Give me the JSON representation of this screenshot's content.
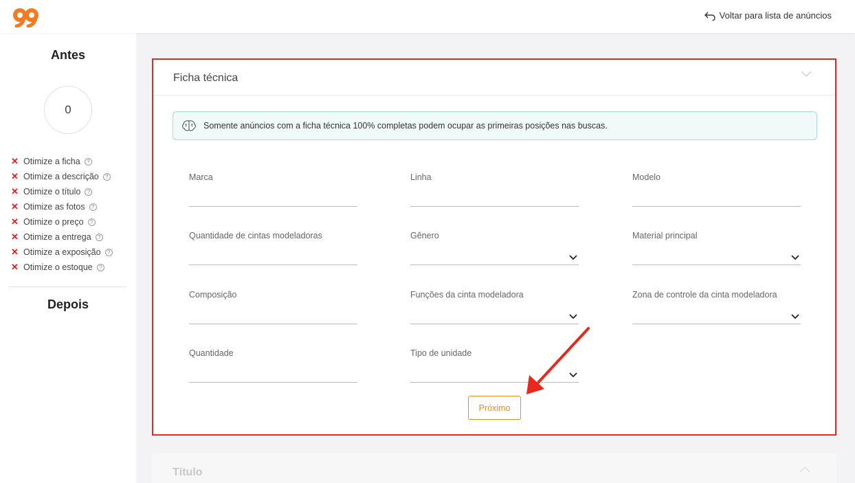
{
  "header": {
    "back_label": "Voltar para lista de anúncios"
  },
  "sidebar": {
    "antes_title": "Antes",
    "score": "0",
    "items": [
      {
        "label": "Otimize a ficha"
      },
      {
        "label": "Otimize a descrição"
      },
      {
        "label": "Otimize o título"
      },
      {
        "label": "Otimize as fotos"
      },
      {
        "label": "Otimize o preço"
      },
      {
        "label": "Otimize a entrega"
      },
      {
        "label": "Otimize a exposição"
      },
      {
        "label": "Otimize o estoque"
      }
    ],
    "depois_title": "Depois"
  },
  "ficha": {
    "title": "Ficha técnica",
    "info": "Somente anúncios com a ficha técnica 100% completas podem ocupar as primeiras posições nas buscas.",
    "fields": [
      {
        "label": "Marca",
        "type": "text"
      },
      {
        "label": "Linha",
        "type": "text"
      },
      {
        "label": "Modelo",
        "type": "text"
      },
      {
        "label": "Quantidade de cintas modeladoras",
        "type": "text"
      },
      {
        "label": "Gênero",
        "type": "select"
      },
      {
        "label": "Material principal",
        "type": "select"
      },
      {
        "label": "Composição",
        "type": "text"
      },
      {
        "label": "Funções da cinta modeladora",
        "type": "select"
      },
      {
        "label": "Zona de controle da cinta modeladora",
        "type": "select"
      },
      {
        "label": "Quantidade",
        "type": "text"
      },
      {
        "label": "Tipo de unidade",
        "type": "select"
      }
    ],
    "next_label": "Próximo"
  },
  "next_section": {
    "title": "Título"
  },
  "colors": {
    "accent": "#f08a24",
    "highlight": "#e8281e",
    "error": "#e02020",
    "info_bg": "#f0faf8"
  }
}
